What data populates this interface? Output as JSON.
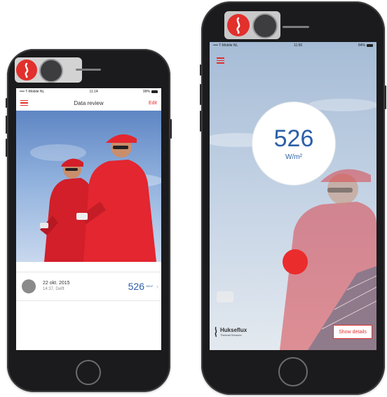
{
  "left_phone": {
    "status": {
      "carrier": "•••• T-Mobile NL",
      "time": "11:14",
      "battery": "99%"
    },
    "nav": {
      "title": "Data review",
      "edit_label": "Edit"
    },
    "entry": {
      "date": "22 okt. 2015",
      "subtitle": "14:37, Delft",
      "value": "526",
      "unit": "W/m²"
    }
  },
  "right_phone": {
    "status": {
      "carrier": "•••• T-Mobile NL",
      "time": "11:55",
      "battery": "84%"
    },
    "reading": {
      "value": "526",
      "unit": "W/m²"
    },
    "brand": {
      "name": "Hukseflux",
      "subtitle": "Thermal Sensors"
    },
    "details_button": "Show details"
  },
  "colors": {
    "accent": "#e2302c",
    "value_blue": "#2b5fa8",
    "record": "#ea2c2c"
  },
  "icons": [
    "hamburger-menu-icon",
    "chevron-right-icon",
    "brand-logo-icon"
  ]
}
